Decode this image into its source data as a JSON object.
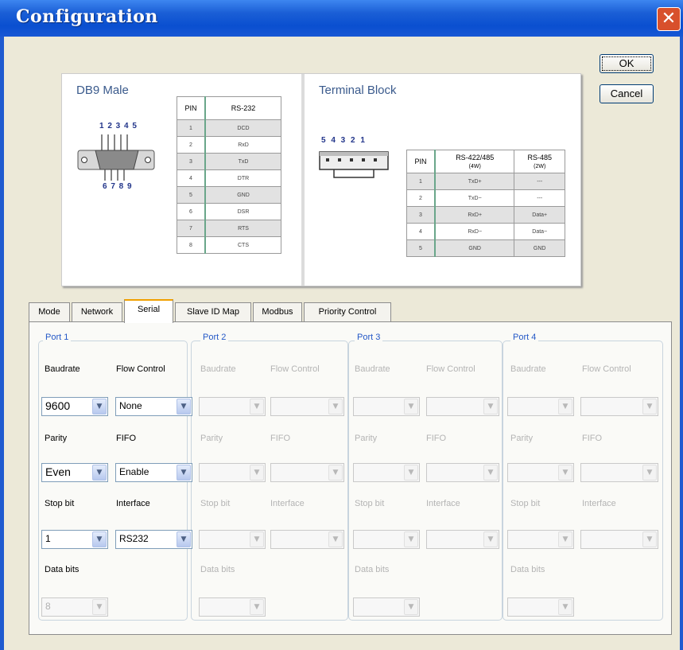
{
  "window": {
    "title": "Configuration",
    "close_glyph": "✕"
  },
  "buttons": {
    "ok": "OK",
    "cancel": "Cancel"
  },
  "diagram": {
    "db9": {
      "title": "DB9 Male",
      "pins_top": "1 2 3 4 5",
      "pins_bottom": "6 7 8 9",
      "table": {
        "headers": [
          "PIN",
          "RS-232"
        ],
        "rows": [
          [
            "1",
            "DCD"
          ],
          [
            "2",
            "RxD"
          ],
          [
            "3",
            "TxD"
          ],
          [
            "4",
            "DTR"
          ],
          [
            "5",
            "GND"
          ],
          [
            "6",
            "DSR"
          ],
          [
            "7",
            "RTS"
          ],
          [
            "8",
            "CTS"
          ]
        ]
      }
    },
    "terminal": {
      "title": "Terminal Block",
      "pins": "5 4 3 2 1",
      "table": {
        "headers": [
          "PIN",
          "RS-422/485",
          "RS-485"
        ],
        "subheaders": [
          "",
          "(4W)",
          "(2W)"
        ],
        "rows": [
          [
            "1",
            "TxD+",
            "---"
          ],
          [
            "2",
            "TxD−",
            "---"
          ],
          [
            "3",
            "RxD+",
            "Data+"
          ],
          [
            "4",
            "RxD−",
            "Data−"
          ],
          [
            "5",
            "GND",
            "GND"
          ]
        ]
      }
    }
  },
  "tabs": [
    "Mode",
    "Network",
    "Serial",
    "Slave ID Map",
    "Modbus",
    "Priority Control"
  ],
  "active_tab": "Serial",
  "labels": {
    "baudrate": "Baudrate",
    "flow_control": "Flow Control",
    "parity": "Parity",
    "fifo": "FIFO",
    "stop_bit": "Stop bit",
    "interface": "Interface",
    "data_bits": "Data bits"
  },
  "ports": [
    {
      "title": "Port 1",
      "enabled": true,
      "baudrate": "9600",
      "flow_control": "None",
      "parity": "Even",
      "fifo": "Enable",
      "stop_bit": "1",
      "interface": "RS232",
      "data_bits": "8"
    },
    {
      "title": "Port 2",
      "enabled": false
    },
    {
      "title": "Port 3",
      "enabled": false
    },
    {
      "title": "Port 4",
      "enabled": false
    }
  ],
  "colors": {
    "title_bar": "#0a4fd0",
    "group_title": "#2458c7",
    "close_button": "#d8502c"
  }
}
